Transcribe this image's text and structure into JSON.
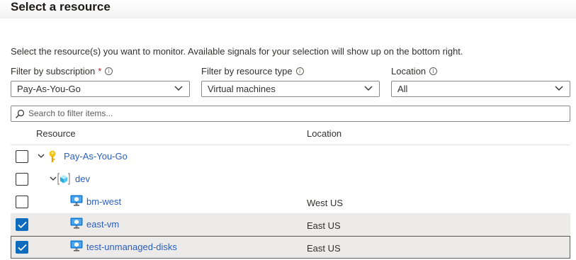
{
  "page": {
    "title": "Select a resource"
  },
  "description": "Select the resource(s) you want to monitor. Available signals for your selection will show up on the bottom right.",
  "filters": {
    "subscription": {
      "label": "Filter by subscription",
      "required_mark": "*",
      "value": "Pay-As-You-Go"
    },
    "resource_type": {
      "label": "Filter by resource type",
      "value": "Virtual machines"
    },
    "location": {
      "label": "Location",
      "value": "All"
    },
    "info_glyph": "i"
  },
  "search": {
    "placeholder": "Search to filter items..."
  },
  "table": {
    "columns": [
      "Resource",
      "Location"
    ],
    "rows": [
      {
        "name": "Pay-As-You-Go",
        "location": "",
        "checked": false,
        "icon": "key-icon"
      },
      {
        "name": "dev",
        "location": "",
        "checked": false,
        "icon": "resource-group-icon"
      },
      {
        "name": "bm-west",
        "location": "West US",
        "checked": false,
        "icon": "virtual-machine-icon"
      },
      {
        "name": "east-vm",
        "location": "East US",
        "checked": true,
        "icon": "virtual-machine-icon"
      },
      {
        "name": "test-unmanaged-disks",
        "location": "East US",
        "checked": true,
        "icon": "virtual-machine-icon"
      }
    ]
  },
  "colors": {
    "link": "#2a5ebd",
    "checkbox_checked": "#0f6cbd",
    "selected_row": "#edebe9"
  }
}
